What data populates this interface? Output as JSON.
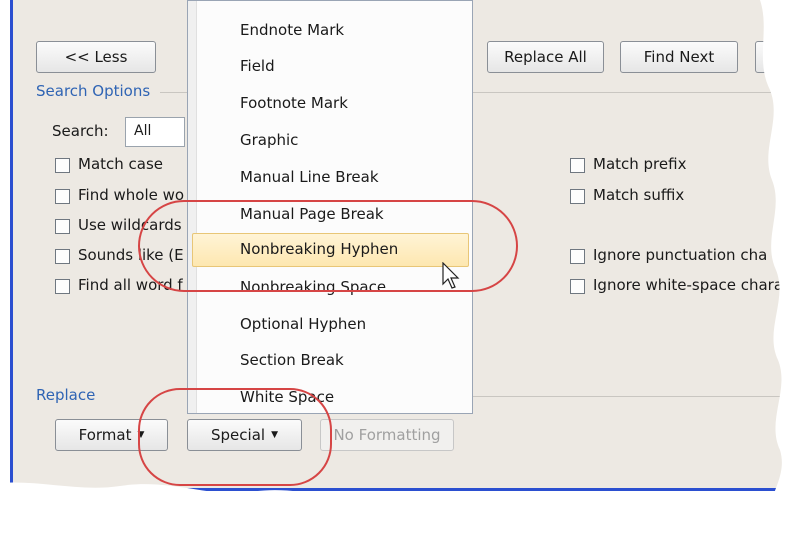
{
  "buttons": {
    "less": "<< Less",
    "replace_all": "Replace All",
    "find_next": "Find Next",
    "format": "Format",
    "special": "Special",
    "no_formatting": "No Formatting"
  },
  "search_options": {
    "label": "Search Options",
    "search_label": "Search:",
    "search_value": "All",
    "checkboxes_left": [
      "Match case",
      "Find whole wo",
      "Use wildcards",
      "Sounds like (E",
      "Find all word f"
    ],
    "checkboxes_right": [
      "Match prefix",
      "Match suffix",
      "Ignore punctuation cha",
      "Ignore white-space chara"
    ]
  },
  "replace": {
    "label": "Replace"
  },
  "special_menu": {
    "items": [
      "Endnote Mark",
      "Field",
      "Footnote Mark",
      "Graphic",
      "Manual Line Break",
      "Manual Page Break",
      "Nonbreaking Hyphen",
      "Nonbreaking Space",
      "Optional Hyphen",
      "Section Break",
      "White Space"
    ],
    "highlighted": "Nonbreaking Hyphen"
  },
  "colors": {
    "annotation": "#d64545",
    "accent": "#2f64b4",
    "highlight": "#fde7b0"
  }
}
